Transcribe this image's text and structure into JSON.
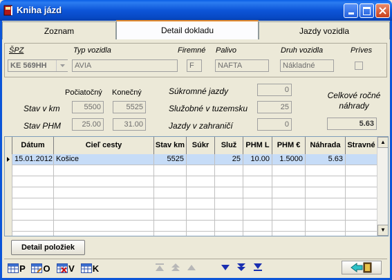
{
  "window": {
    "title": "Kniha jázd"
  },
  "tabs": [
    {
      "label": "Zoznam"
    },
    {
      "label": "Detail dokladu"
    },
    {
      "label": "Jazdy vozidla"
    }
  ],
  "header": {
    "spz_label": "ŠPZ",
    "spz_value": "KE 569HH",
    "typ_label": "Typ vozidla",
    "typ_value": "AVIA",
    "firemne_label": "Firemné",
    "firemne_value": "F",
    "palivo_label": "Palivo",
    "palivo_value": "NAFTA",
    "druh_label": "Druh vozidla",
    "druh_value": "Nákladné",
    "prives_label": "Príves"
  },
  "stats": {
    "pociatocny_label": "Počiatočný",
    "konecny_label": "Konečný",
    "stav_km_label": "Stav v km",
    "stav_km_start": "5500",
    "stav_km_end": "5525",
    "stav_phm_label": "Stav PHM",
    "stav_phm_start": "25.00",
    "stav_phm_end": "31.00",
    "sukromne_label": "Súkromné jazdy",
    "sukromne_value": "0",
    "sluzobne_label": "Služobné v tuzemsku",
    "sluzobne_value": "25",
    "zahranici_label": "Jazdy v zahraničí",
    "zahranici_value": "0",
    "nahrady_label_1": "Celkové ročné",
    "nahrady_label_2": "náhrady",
    "nahrady_value": "5.63"
  },
  "grid": {
    "columns": [
      "Dátum",
      "Cieľ cesty",
      "Stav km",
      "Súkr",
      "Služ",
      "PHM L",
      "PHM €",
      "Náhrada",
      "Stravné"
    ],
    "rows": [
      {
        "datum": "15.01.2012",
        "ciel": "Košice",
        "stav_km": "5525",
        "sukr": "",
        "sluz": "25",
        "phm_l": "10.00",
        "phm_eur": "1.5000",
        "nahrada": "5.63",
        "stravne": ""
      }
    ]
  },
  "buttons": {
    "detail": "Detail položiek",
    "tool_p": "P",
    "tool_o": "O",
    "tool_v": "V",
    "tool_k": "K"
  },
  "colors": {
    "titlebar": "#0a5fe6",
    "selected_row": "#c6dcf7",
    "active_tab_accent": "#e68b2c",
    "nav_arrow": "#1a2fb0"
  }
}
